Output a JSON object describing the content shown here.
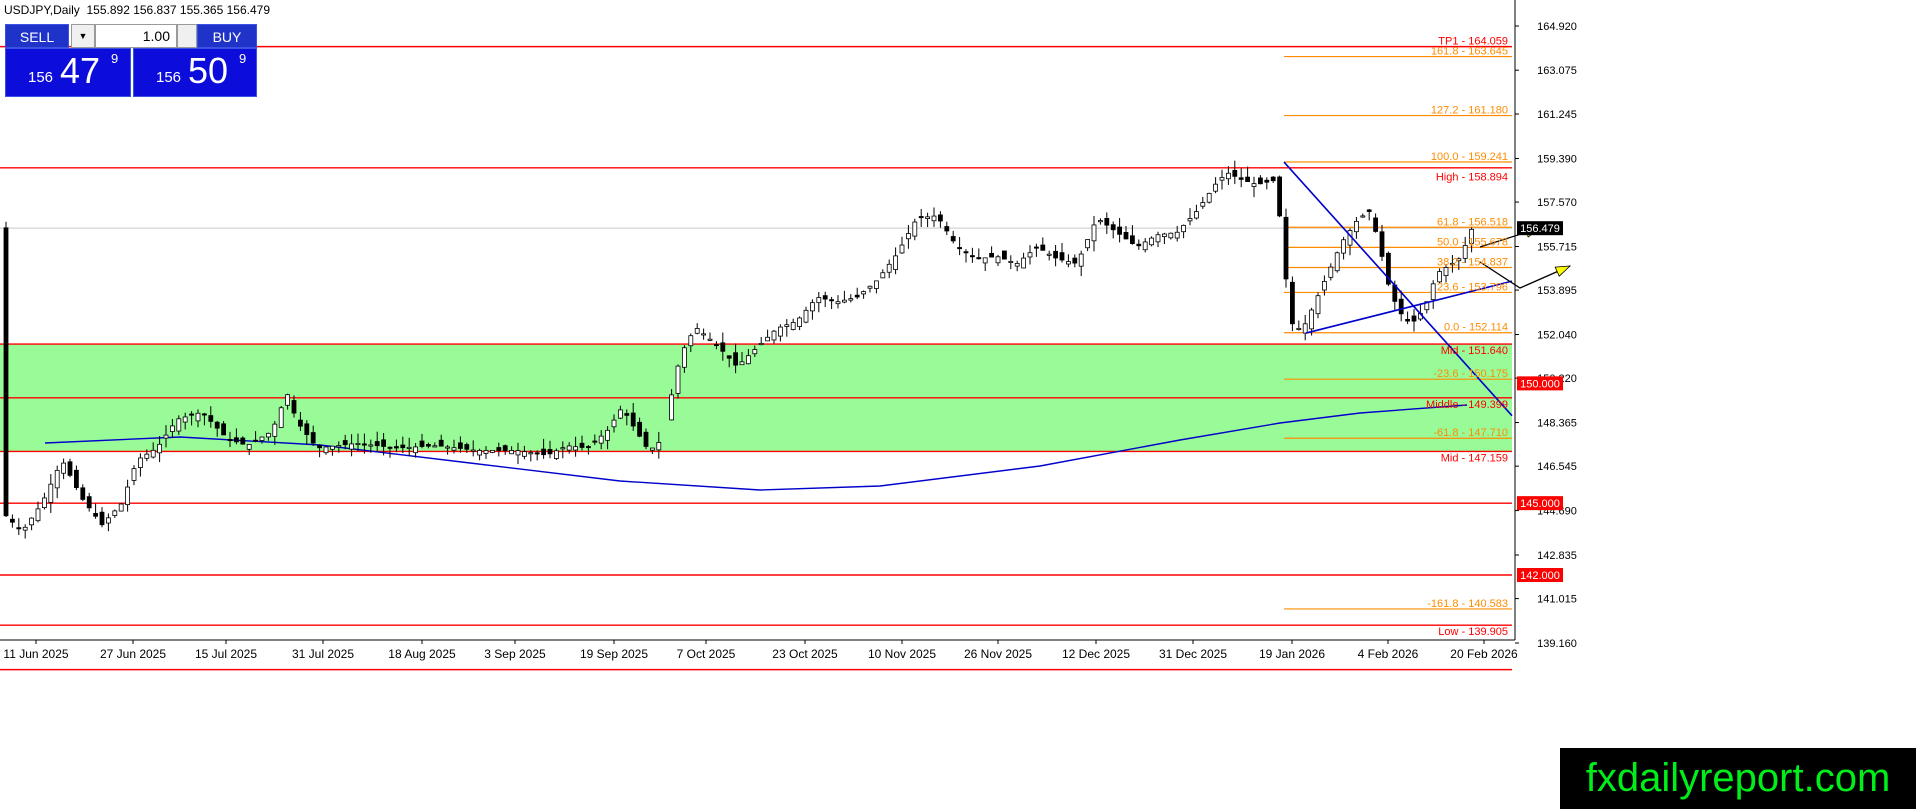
{
  "header": {
    "symbol": "USDJPY,Daily",
    "ohlc": "155.892 156.837 155.365 156.479"
  },
  "trade_panel": {
    "sell_label": "SELL",
    "buy_label": "BUY",
    "lot": "1.00",
    "bid": {
      "prefix": "156",
      "big": "47",
      "sup": "9"
    },
    "ask": {
      "prefix": "156",
      "big": "50",
      "sup": "9"
    }
  },
  "brand": "fxdailyreport.com",
  "chart_data": {
    "type": "candlestick",
    "symbol": "USDJPY",
    "timeframe": "Daily",
    "ylim": [
      137.6,
      165.8
    ],
    "y_ticks": [
      164.92,
      163.075,
      161.245,
      159.39,
      157.57,
      155.715,
      153.895,
      152.04,
      150.22,
      148.365,
      146.545,
      144.69,
      142.835,
      141.015,
      139.16
    ],
    "x_ticks": [
      "11 Jun 2025",
      "27 Jun 2025",
      "15 Jul 2025",
      "31 Jul 2025",
      "18 Aug 2025",
      "3 Sep 2025",
      "19 Sep 2025",
      "7 Oct 2025",
      "23 Oct 2025",
      "10 Nov 2025",
      "26 Nov 2025",
      "12 Dec 2025",
      "31 Dec 2025",
      "19 Jan 2026",
      "4 Feb 2026",
      "20 Feb 2026"
    ],
    "current_price": "156.479",
    "green_zone": [
      147.159,
      151.64
    ],
    "horizontal_levels": [
      {
        "value": 164.059,
        "label": "TP1 - 164.059",
        "color": "#ff0000"
      },
      {
        "value": 159.0,
        "label": "",
        "color": "#ff0000"
      },
      {
        "value": 151.64,
        "label": "",
        "color": "#ff0000"
      },
      {
        "value": 149.399,
        "label": "",
        "color": "#ff0000"
      },
      {
        "value": 147.159,
        "label": "",
        "color": "#ff0000"
      },
      {
        "value": 145.0,
        "label": "145.000",
        "color": "#ff0000"
      },
      {
        "value": 142.0,
        "label": "142.000",
        "color": "#ff0000"
      },
      {
        "value": 139.905,
        "label": "",
        "color": "#ff0000"
      },
      {
        "value": 138.05,
        "label": "",
        "color": "#ff0000"
      }
    ],
    "box_labels": [
      {
        "value": 150.0,
        "text": "150.000"
      },
      {
        "value": 145.0,
        "text": "145.000"
      },
      {
        "value": 142.0,
        "text": "142.000"
      }
    ],
    "fib_levels": [
      {
        "value": 163.645,
        "label": "161.8 - 163.645"
      },
      {
        "value": 161.18,
        "label": "127.2 - 161.180"
      },
      {
        "value": 159.241,
        "label": "100.0 - 159.241"
      },
      {
        "value": 156.518,
        "label": "61.8 - 156.518"
      },
      {
        "value": 155.678,
        "label": "50.0 - 155.678"
      },
      {
        "value": 154.837,
        "label": "38.2 - 154.837"
      },
      {
        "value": 153.796,
        "label": "23.6 - 153.796"
      },
      {
        "value": 152.114,
        "label": "0.0 - 152.114"
      },
      {
        "value": 150.175,
        "label": "-23.6 - 150.175"
      },
      {
        "value": 147.71,
        "label": "-61.8 - 147.710"
      },
      {
        "value": 140.583,
        "label": "-161.8 - 140.583"
      }
    ],
    "red_labels": [
      {
        "value": 158.894,
        "label": "High - 158.894"
      },
      {
        "value": 151.64,
        "label": "Mid - 151.640"
      },
      {
        "value": 149.399,
        "label": "Middle - 149.399"
      },
      {
        "value": 147.159,
        "label": "Mid - 147.159"
      },
      {
        "value": 139.905,
        "label": "Low - 139.905"
      }
    ],
    "colors": {
      "bull": "#ffffff",
      "bear": "#000000",
      "ma": "#0000cc",
      "trend": "#0000cc",
      "zone": "#98fb98",
      "red": "#ff0000",
      "fib": "#ff8c00",
      "arrow": "#ffff00"
    }
  }
}
